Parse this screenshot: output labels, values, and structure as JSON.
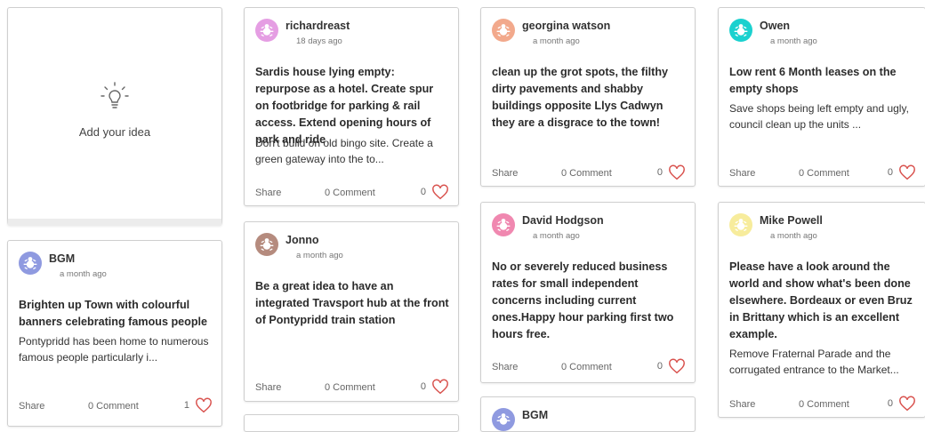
{
  "add_idea": {
    "label": "Add your idea"
  },
  "actions": {
    "share": "Share"
  },
  "cards": [
    {
      "author": "richardreast",
      "time": "18 days ago",
      "avatar_color": "#e59ee3",
      "title": "Sardis house lying empty: repurpose as a hotel. Create spur on footbridge for parking & rail access. Extend opening hours of park and ride",
      "description": "Don't build on old bingo site. Create a green gateway into the to...",
      "comments": "0 Comment",
      "likes": "0"
    },
    {
      "author": "georgina watson",
      "time": "a month ago",
      "avatar_color": "#f2a98c",
      "title": "clean up the grot spots, the filthy dirty pavements and shabby buildings opposite Llys Cadwyn they are a disgrace to the town!",
      "description": "",
      "comments": "0 Comment",
      "likes": "0"
    },
    {
      "author": "Owen",
      "time": "a month ago",
      "avatar_color": "#1bd1cf",
      "title": "Low rent 6 Month leases on the empty shops",
      "description": "Save shops being left empty and ugly, council clean up the units ...",
      "comments": "0 Comment",
      "likes": "0"
    },
    {
      "author": "BGM",
      "time": "a month ago",
      "avatar_color": "#8f9ae0",
      "title": "Brighten up Town with colourful banners celebrating famous people",
      "description": "Pontypridd has been home to numerous famous people particularly i...",
      "comments": "0 Comment",
      "likes": "1"
    },
    {
      "author": "Jonno",
      "time": "a month ago",
      "avatar_color": "#b58b7e",
      "title": "Be a great idea to have an integrated Travsport hub at the front of Pontypridd train station",
      "description": "",
      "comments": "0 Comment",
      "likes": "0"
    },
    {
      "author": "David Hodgson",
      "time": "a month ago",
      "avatar_color": "#f088b0",
      "title": "No or severely reduced business rates for small independent concerns including current ones.Happy hour parking first two hours free.",
      "description": "",
      "comments": "0 Comment",
      "likes": "0"
    },
    {
      "author": "Mike Powell",
      "time": "a month ago",
      "avatar_color": "#f7ec9c",
      "title": "Please have a look around the world and show what's been done elsewhere. Bordeaux or even Bruz in Brittany which is an excellent example.",
      "description": "Remove Fraternal Parade and the corrugated entrance to the Market...",
      "comments": "0 Comment",
      "likes": "0"
    },
    {
      "author": "BGM",
      "time": "",
      "avatar_color": "#8f9ae0",
      "title": "",
      "description": "",
      "comments": "",
      "likes": ""
    }
  ]
}
